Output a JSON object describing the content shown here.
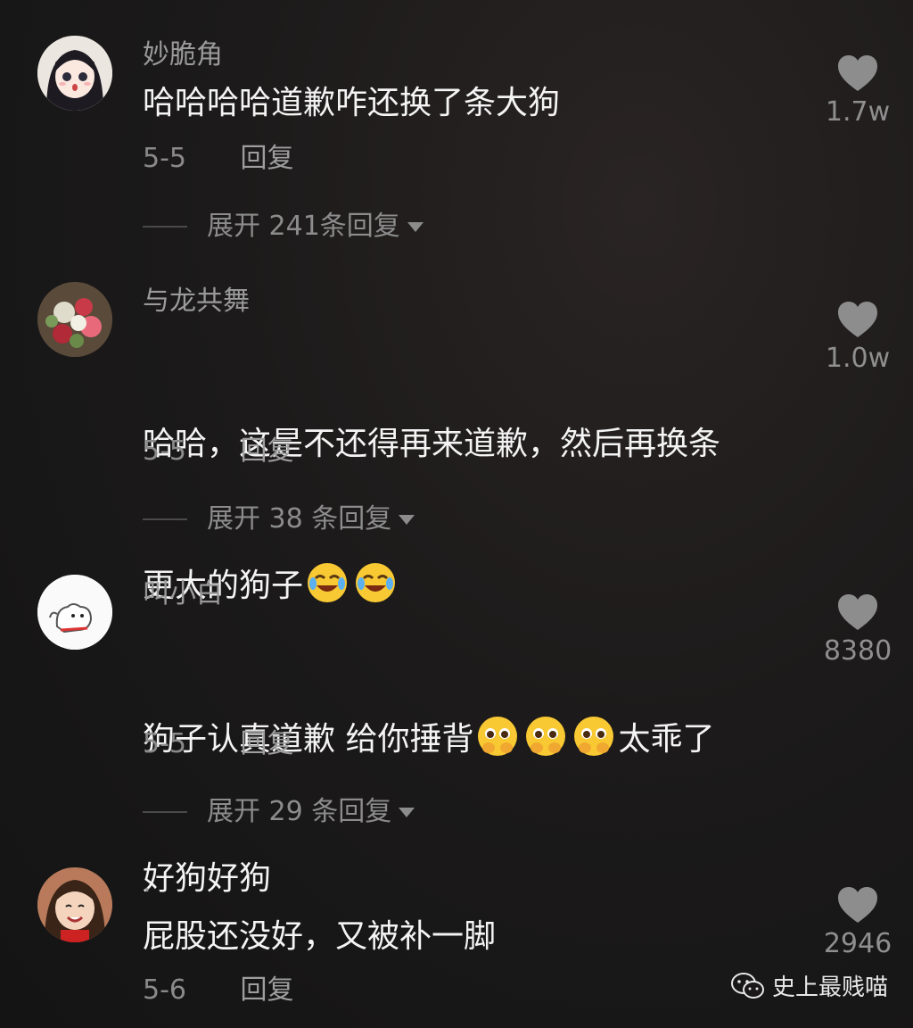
{
  "comments": [
    {
      "username": "妙脆角",
      "text": "哈哈哈哈道歉咋还换了条大狗",
      "date": "5-5",
      "reply_label": "回复",
      "likes": "1.7w",
      "expand": "展开 241条回复"
    },
    {
      "username": "与龙共舞",
      "text_line1": "哈哈，这是不还得再来道歉，然后再换条",
      "text_line2": "更大的狗子",
      "date": "5-5",
      "reply_label": "回复",
      "likes": "1.0w",
      "expand": "展开 38 条回复"
    },
    {
      "username": "叫小白",
      "text_line1a": "狗子认真道歉 给你捶背",
      "text_line1b": "太乖了",
      "text_line2": "好狗好狗",
      "date": "5-5",
      "reply_label": "回复",
      "likes": "8380",
      "expand": "展开 29 条回复"
    },
    {
      "username": ".",
      "text": "屁股还没好，又被补一脚",
      "date": "5-6",
      "reply_label": "回复",
      "likes": "2946"
    }
  ],
  "watermark": {
    "label": "史上最贱喵"
  },
  "colors": {
    "background": "#1a1818",
    "muted": "#8c8c8c",
    "text": "#f4f4f4"
  },
  "icons": [
    "heart-icon",
    "crying-laughing-emoji",
    "pleading-face-emoji",
    "wechat-icon"
  ]
}
